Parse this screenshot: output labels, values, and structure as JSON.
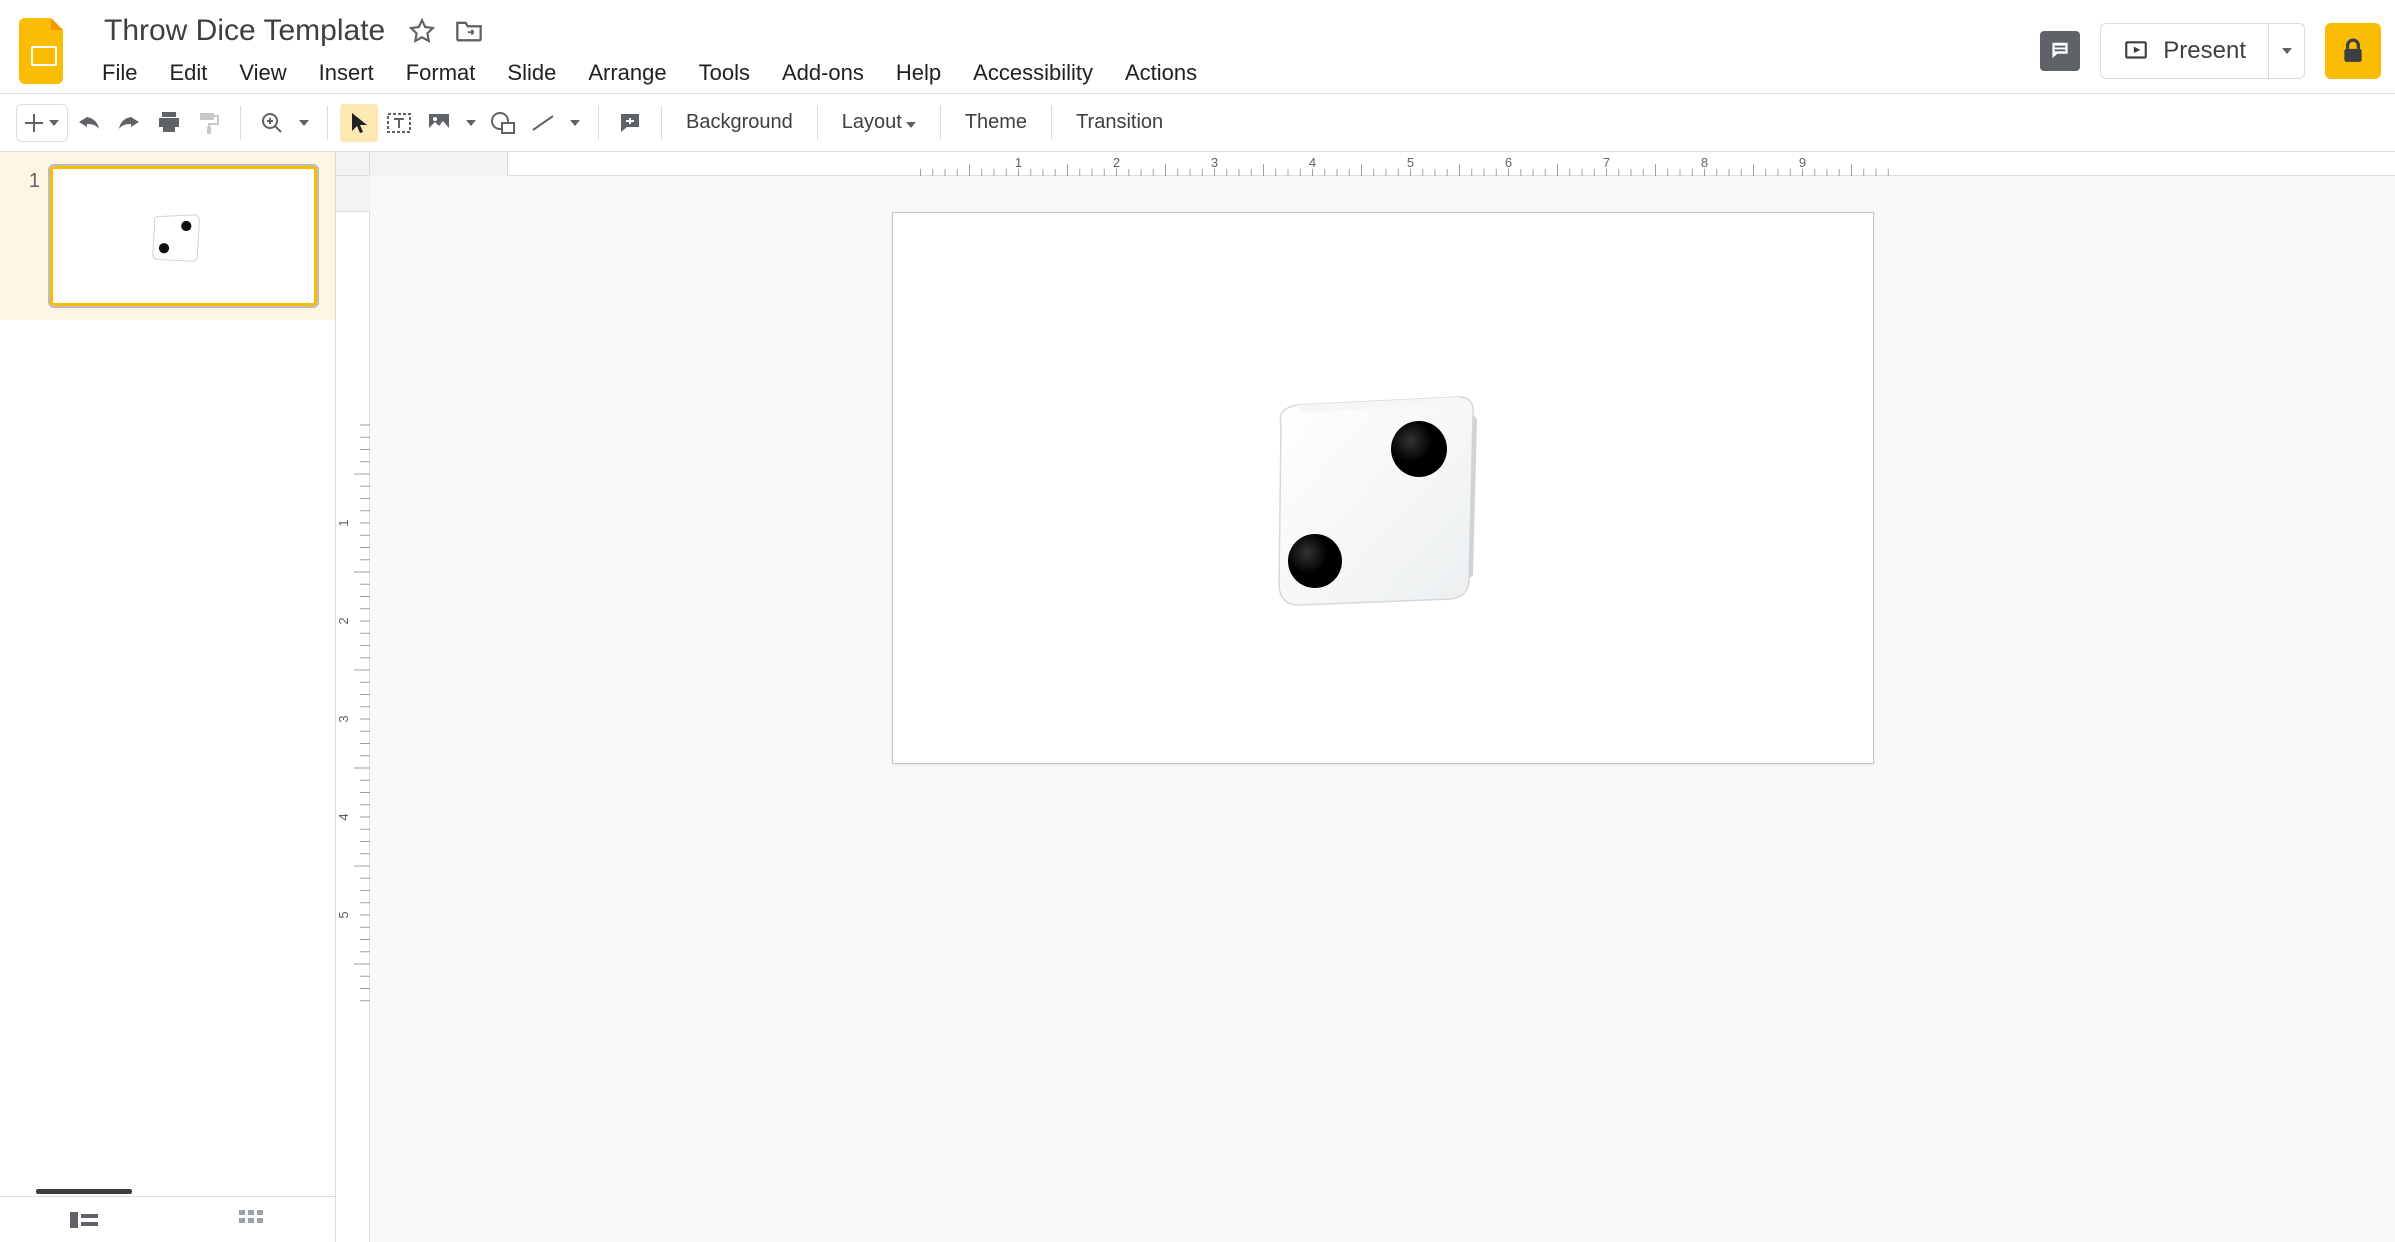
{
  "doc": {
    "title": "Throw Dice Template"
  },
  "menus": {
    "file": "File",
    "edit": "Edit",
    "view": "View",
    "insert": "Insert",
    "format": "Format",
    "slide": "Slide",
    "arrange": "Arrange",
    "tools": "Tools",
    "addons": "Add-ons",
    "help": "Help",
    "accessibility": "Accessibility",
    "actions": "Actions"
  },
  "header": {
    "present": "Present"
  },
  "toolbar": {
    "background": "Background",
    "layout": "Layout",
    "theme": "Theme",
    "transition": "Transition"
  },
  "filmstrip": {
    "slides": [
      {
        "number": "1"
      }
    ]
  },
  "ruler": {
    "h": [
      "1",
      "2",
      "3",
      "4",
      "5",
      "6",
      "7",
      "8",
      "9"
    ],
    "v": [
      "1",
      "2",
      "3",
      "4",
      "5"
    ]
  },
  "slide_content": {
    "dice_value": 2
  }
}
